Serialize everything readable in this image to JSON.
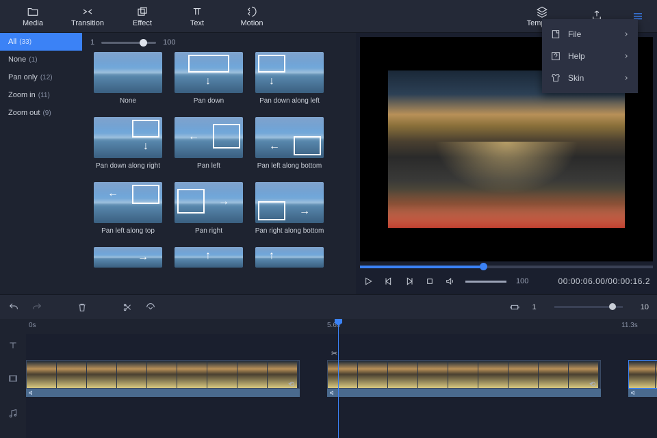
{
  "top_tabs": [
    {
      "label": "Media"
    },
    {
      "label": "Transition"
    },
    {
      "label": "Effect"
    },
    {
      "label": "Text"
    },
    {
      "label": "Motion"
    },
    {
      "label": "Template"
    },
    {
      "label": ""
    }
  ],
  "dropdown": {
    "items": [
      {
        "label": "File"
      },
      {
        "label": "Help"
      },
      {
        "label": "Skin"
      }
    ]
  },
  "sidebar": {
    "items": [
      {
        "label": "All",
        "count": "(33)"
      },
      {
        "label": "None",
        "count": "(1)"
      },
      {
        "label": "Pan only",
        "count": "(12)"
      },
      {
        "label": "Zoom in",
        "count": "(11)"
      },
      {
        "label": "Zoom out",
        "count": "(9)"
      }
    ]
  },
  "effects_slider": {
    "min": "1",
    "max": "100"
  },
  "effects": [
    {
      "label": "None"
    },
    {
      "label": "Pan down"
    },
    {
      "label": "Pan down along left"
    },
    {
      "label": "Pan down along right"
    },
    {
      "label": "Pan left"
    },
    {
      "label": "Pan left along bottom"
    },
    {
      "label": "Pan left along top"
    },
    {
      "label": "Pan right"
    },
    {
      "label": "Pan right along bottom"
    }
  ],
  "preview": {
    "volume": "100",
    "time": "00:00:06.00/00:00:16.2"
  },
  "timeline": {
    "zoom_min": "1",
    "zoom_max": "10",
    "ruler": [
      "0s",
      "5.6s",
      "11.3s"
    ]
  }
}
